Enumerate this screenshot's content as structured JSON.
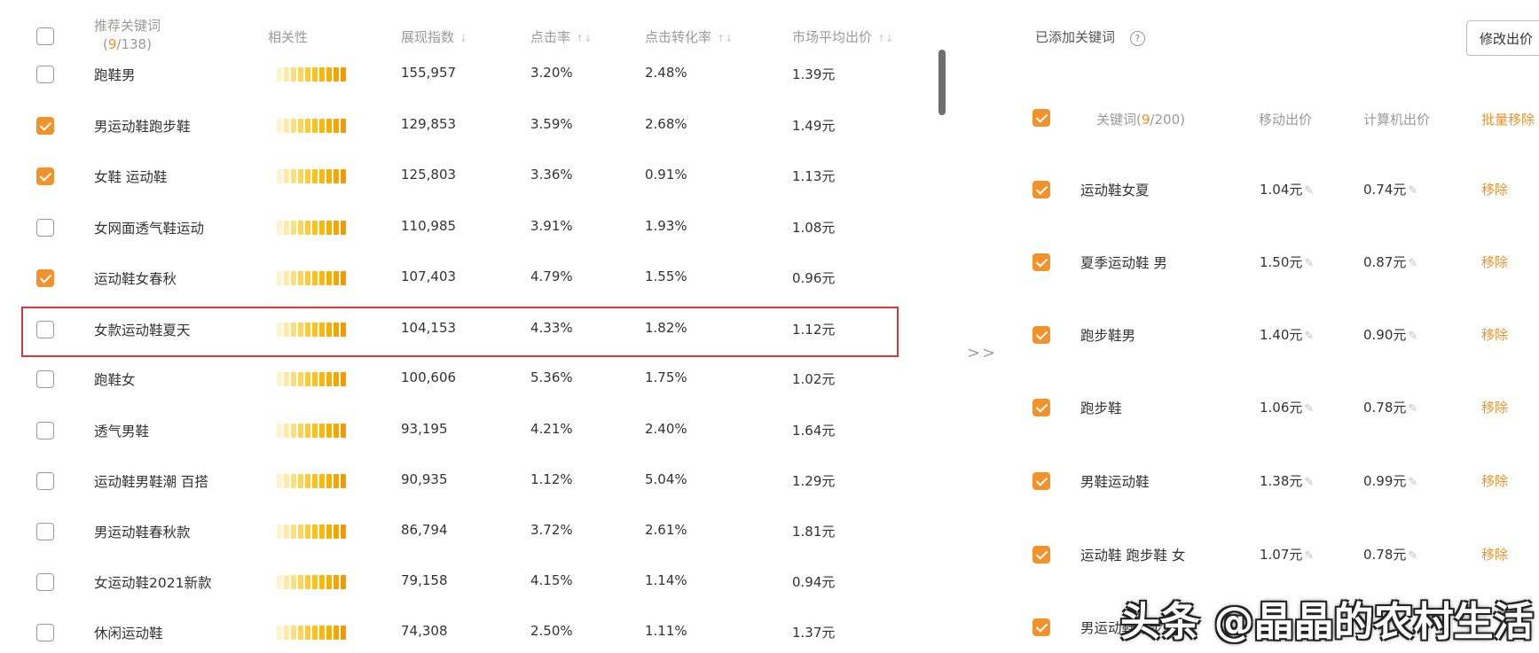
{
  "left": {
    "header": {
      "keyword": "推荐关键词",
      "count_open": "(",
      "count_selected": "9",
      "count_total": "/138)",
      "relevance": "相关性",
      "impressions": "展现指数",
      "ctr": "点击率",
      "cvr": "点击转化率",
      "avg_bid": "市场平均出价"
    },
    "rows": [
      {
        "keyword": "跑鞋男",
        "impressions": "155,957",
        "ctr": "3.20%",
        "cvr": "2.48%",
        "bid": "1.39元",
        "checked": false
      },
      {
        "keyword": "男运动鞋跑步鞋",
        "impressions": "129,853",
        "ctr": "3.59%",
        "cvr": "2.68%",
        "bid": "1.49元",
        "checked": true
      },
      {
        "keyword": "女鞋 运动鞋",
        "impressions": "125,803",
        "ctr": "3.36%",
        "cvr": "0.91%",
        "bid": "1.13元",
        "checked": true
      },
      {
        "keyword": "女网面透气鞋运动",
        "impressions": "110,985",
        "ctr": "3.91%",
        "cvr": "1.93%",
        "bid": "1.08元",
        "checked": false
      },
      {
        "keyword": "运动鞋女春秋",
        "impressions": "107,403",
        "ctr": "4.79%",
        "cvr": "1.55%",
        "bid": "0.96元",
        "checked": true
      },
      {
        "keyword": "女款运动鞋夏天",
        "impressions": "104,153",
        "ctr": "4.33%",
        "cvr": "1.82%",
        "bid": "1.12元",
        "checked": false
      },
      {
        "keyword": "跑鞋女",
        "impressions": "100,606",
        "ctr": "5.36%",
        "cvr": "1.75%",
        "bid": "1.02元",
        "checked": false
      },
      {
        "keyword": "透气男鞋",
        "impressions": "93,195",
        "ctr": "4.21%",
        "cvr": "2.40%",
        "bid": "1.64元",
        "checked": false
      },
      {
        "keyword": "运动鞋男鞋潮 百搭",
        "impressions": "90,935",
        "ctr": "1.12%",
        "cvr": "5.04%",
        "bid": "1.29元",
        "checked": false
      },
      {
        "keyword": "男运动鞋春秋款",
        "impressions": "86,794",
        "ctr": "3.72%",
        "cvr": "2.61%",
        "bid": "1.81元",
        "checked": false
      },
      {
        "keyword": "女运动鞋2021新款",
        "impressions": "79,158",
        "ctr": "4.15%",
        "cvr": "1.14%",
        "bid": "0.94元",
        "checked": false
      },
      {
        "keyword": "休闲运动鞋",
        "impressions": "74,308",
        "ctr": "2.50%",
        "cvr": "1.11%",
        "bid": "1.37元",
        "checked": false
      }
    ],
    "relevance_level": 10
  },
  "transfer_label": ">>",
  "right": {
    "title": "已添加关键词",
    "help_icon": "?",
    "modify_button": "修改出价",
    "header": {
      "keyword": "关键词",
      "count_open": "(",
      "count_selected": "9",
      "count_total": "/200)",
      "mobile_bid": "移动出价",
      "pc_bid": "计算机出价",
      "batch_remove": "批量移除"
    },
    "rows": [
      {
        "keyword": "运动鞋女夏",
        "mobile": "1.04元",
        "pc": "0.74元",
        "remove": "移除"
      },
      {
        "keyword": "夏季运动鞋 男",
        "mobile": "1.50元",
        "pc": "0.87元",
        "remove": "移除"
      },
      {
        "keyword": "跑步鞋男",
        "mobile": "1.40元",
        "pc": "0.90元",
        "remove": "移除"
      },
      {
        "keyword": "跑步鞋",
        "mobile": "1.06元",
        "pc": "0.78元",
        "remove": "移除"
      },
      {
        "keyword": "男鞋运动鞋",
        "mobile": "1.38元",
        "pc": "0.99元",
        "remove": "移除"
      },
      {
        "keyword": "运动鞋 跑步鞋 女",
        "mobile": "1.07元",
        "pc": "0.78元",
        "remove": "移除"
      },
      {
        "keyword": "男运动鞋跑步鞋",
        "mobile": "",
        "pc": "",
        "remove": ""
      }
    ]
  },
  "watermark": "头条 @晶晶的农村生活"
}
